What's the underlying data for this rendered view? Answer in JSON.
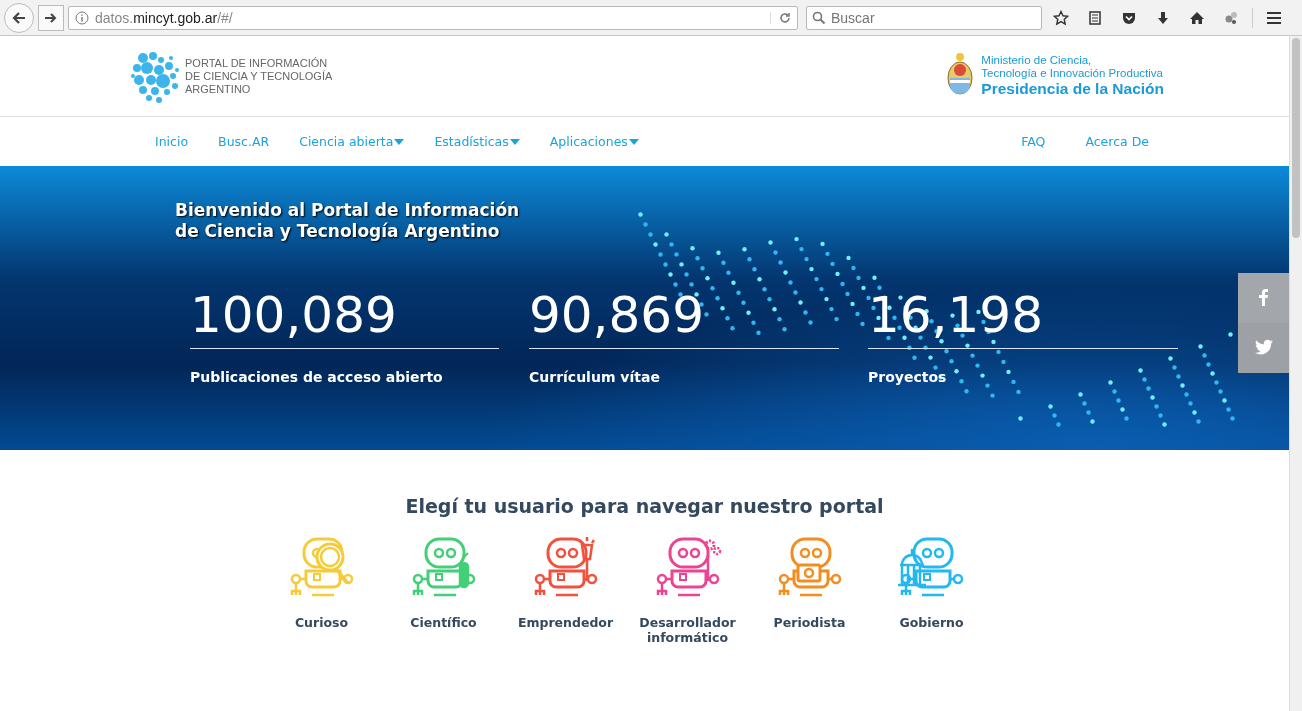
{
  "browser": {
    "url": {
      "prefix": "datos.",
      "domain": "mincyt.gob.ar",
      "suffix": "/#/"
    },
    "search": {
      "placeholder": "Buscar"
    }
  },
  "header": {
    "portal_title": [
      "PORTAL DE INFORMACIÓN",
      "DE CIENCIA Y TECNOLOGÍA",
      "ARGENTINO"
    ],
    "ministry": [
      "Ministerio de Ciencia,",
      "Tecnología e Innovación Productiva"
    ],
    "presidency": "Presidencia de la Nación"
  },
  "nav": {
    "left": [
      {
        "label": "Inicio",
        "dropdown": false
      },
      {
        "label": "Busc.AR",
        "dropdown": false
      },
      {
        "label": "Ciencia abierta",
        "dropdown": true
      },
      {
        "label": "Estadísticas",
        "dropdown": true
      },
      {
        "label": "Aplicaciones",
        "dropdown": true
      }
    ],
    "right": [
      {
        "label": "FAQ",
        "dropdown": false
      },
      {
        "label": "Acerca De",
        "dropdown": false
      }
    ]
  },
  "hero": {
    "title": [
      "Bienvenido al Portal de Información",
      "de Ciencia y Tecnología Argentino"
    ],
    "stats": [
      {
        "value": "100,089",
        "label": "Publicaciones de acceso abierto"
      },
      {
        "value": "90,869",
        "label": "Currículum vítae"
      },
      {
        "value": "16,198",
        "label": "Proyectos"
      }
    ],
    "social": [
      {
        "kind": "facebook"
      },
      {
        "kind": "twitter"
      }
    ]
  },
  "users": {
    "heading": "Elegí tu usuario para navegar nuestro portal",
    "items": [
      {
        "label": "Curioso",
        "color": "#f6cb3a",
        "kind": "magnifier"
      },
      {
        "label": "Científico",
        "color": "#43cf78",
        "kind": "tube"
      },
      {
        "label": "Emprendedor",
        "color": "#f0523d",
        "kind": "bulb"
      },
      {
        "label": "Desarrollador informático",
        "color": "#ec4393",
        "kind": "gears"
      },
      {
        "label": "Periodista",
        "color": "#f18e22",
        "kind": "camera"
      },
      {
        "label": "Gobierno",
        "color": "#23b8ee",
        "kind": "building"
      }
    ]
  }
}
